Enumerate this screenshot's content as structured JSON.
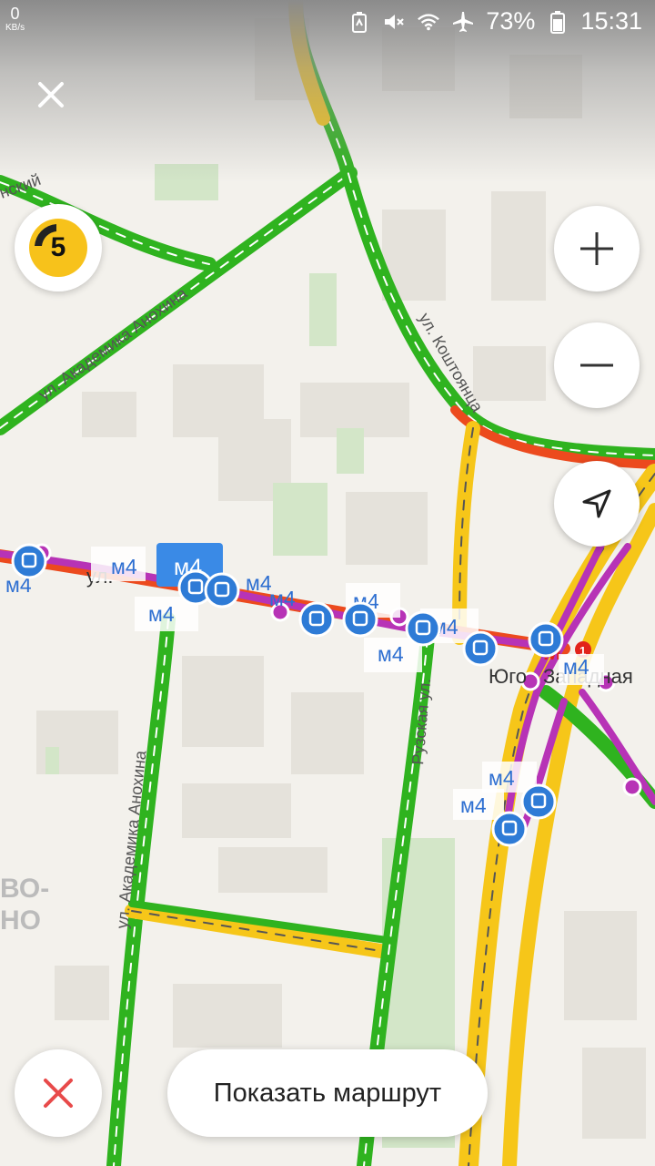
{
  "status_bar": {
    "speed_value": "0",
    "speed_unit": "KB/s",
    "battery_percent": "73%",
    "time": "15:31",
    "icons": [
      "battery-saver-icon",
      "mute-icon",
      "wifi-icon",
      "airplane-icon",
      "battery-icon"
    ]
  },
  "traffic": {
    "level": "5",
    "color": "#f7c21b"
  },
  "controls": {
    "close_icon": "close-icon",
    "zoom_in_icon": "plus-icon",
    "zoom_out_icon": "minus-icon",
    "locate_icon": "location-arrow-icon"
  },
  "map": {
    "streets": {
      "anokhina_top": "ул. Академика Анохина",
      "anokhina_bottom": "ул. Академика Анохина",
      "koshtoyantsa": "ул. Коштоянца",
      "ruzskaya": "Рузская ул.",
      "partial_top_left": "нский",
      "partial_mid_left": "ул.",
      "district_1": "ВО-",
      "district_2": "НО"
    },
    "metro": {
      "station_part1": "Юго",
      "station_part2": "Западная",
      "line_number": "1",
      "metro_icon": "metro-icon"
    },
    "route_label": "м4",
    "route_selected": "м4",
    "colors": {
      "traffic_green": "#2fb31f",
      "traffic_yellow": "#f6c619",
      "traffic_red": "#ec4a1e",
      "route_magenta": "#b733b6",
      "stop_blue": "#2e7bd6"
    }
  },
  "bottom": {
    "show_route_label": "Показать маршрут",
    "cancel_icon": "close-icon"
  }
}
